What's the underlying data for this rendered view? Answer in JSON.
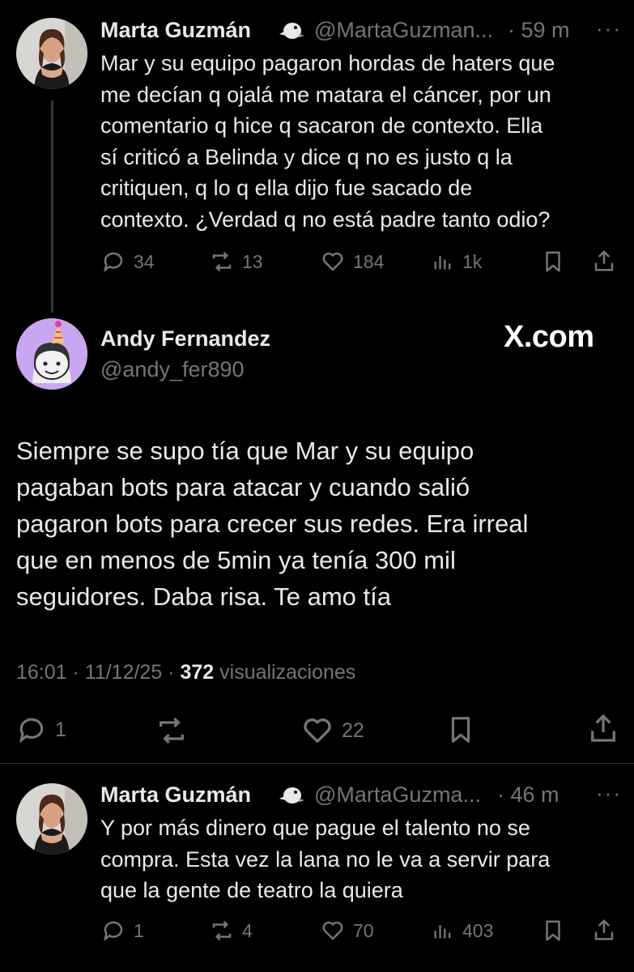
{
  "tweet1": {
    "name": "Marta Guzmán",
    "handle": "@MartaGuzman...",
    "time": "· 59 m",
    "lines": [
      "Mar y su equipo pagaron hordas de haters que",
      "me decían q ojalá me matara el cáncer, por un",
      "comentario q hice q sacaron de contexto. Ella",
      "sí criticó a Belinda y dice q no es justo q la",
      "critiquen, q lo q ella dijo fue sacado de",
      "contexto. ¿Verdad q no está padre tanto odio?"
    ],
    "replies": "34",
    "retweets": "13",
    "likes": "184",
    "views": "1k"
  },
  "tweet2": {
    "name": "Andy Fernandez",
    "handle": "@andy_fer890",
    "brand": "X.com",
    "lines": [
      "Siempre se supo tía que Mar y su equipo",
      "pagaban bots para atacar y cuando salió",
      "pagaron bots para crecer sus redes. Era irreal",
      "que en menos de 5min ya tenía 300 mil",
      "seguidores. Daba risa. Te amo tía"
    ],
    "timestamp": "16:01 · 11/12/25 · ",
    "view_count": "372",
    "view_label": " visualizaciones",
    "replies": "1",
    "likes": "22"
  },
  "tweet3": {
    "name": "Marta Guzmán",
    "handle": "@MartaGuzma...",
    "time": "· 46 m",
    "lines": [
      "Y por más dinero que pague el talento no se",
      "compra. Esta vez la lana no le va a servir para",
      "que la gente de teatro la quiera"
    ],
    "replies": "1",
    "retweets": "4",
    "likes": "70",
    "views": "403"
  },
  "colors": {
    "background": "#000000",
    "text": "#e7e9ea",
    "muted": "#71767b",
    "divider": "#2f3336",
    "andy_avatar_bg": "#c9a6f0"
  }
}
